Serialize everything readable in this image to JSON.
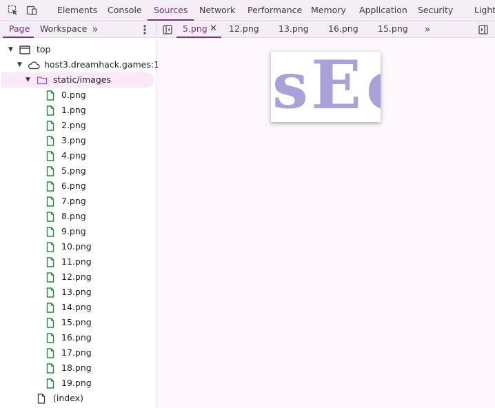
{
  "top_tabs": [
    "Elements",
    "Console",
    "Sources",
    "Network",
    "Performance",
    "Memory",
    "Application",
    "Security",
    "Lighth"
  ],
  "active_top_tab": "Sources",
  "navigator_tabs": [
    "Page",
    "Workspace"
  ],
  "editor_tabs": [
    "5.png",
    "12.png",
    "13.png",
    "16.png",
    "15.png"
  ],
  "tree": {
    "top": "top",
    "host": "host3.dreamhack.games:1...",
    "folder": "static/images",
    "files": [
      "0.png",
      "1.png",
      "2.png",
      "3.png",
      "4.png",
      "5.png",
      "6.png",
      "7.png",
      "8.png",
      "9.png",
      "10.png",
      "11.png",
      "12.png",
      "13.png",
      "14.png",
      "15.png",
      "16.png",
      "17.png",
      "18.png",
      "19.png"
    ],
    "index": "(index)"
  },
  "preview": {
    "glyphs": [
      "s",
      "E",
      "c"
    ]
  },
  "colors": {
    "accent": "#7a2f8a",
    "file_icon": "#1e8e3e",
    "folder_icon": "#a14fb5",
    "selected_row": "#fbe8f7",
    "preview_text": "#a8a2d8"
  }
}
